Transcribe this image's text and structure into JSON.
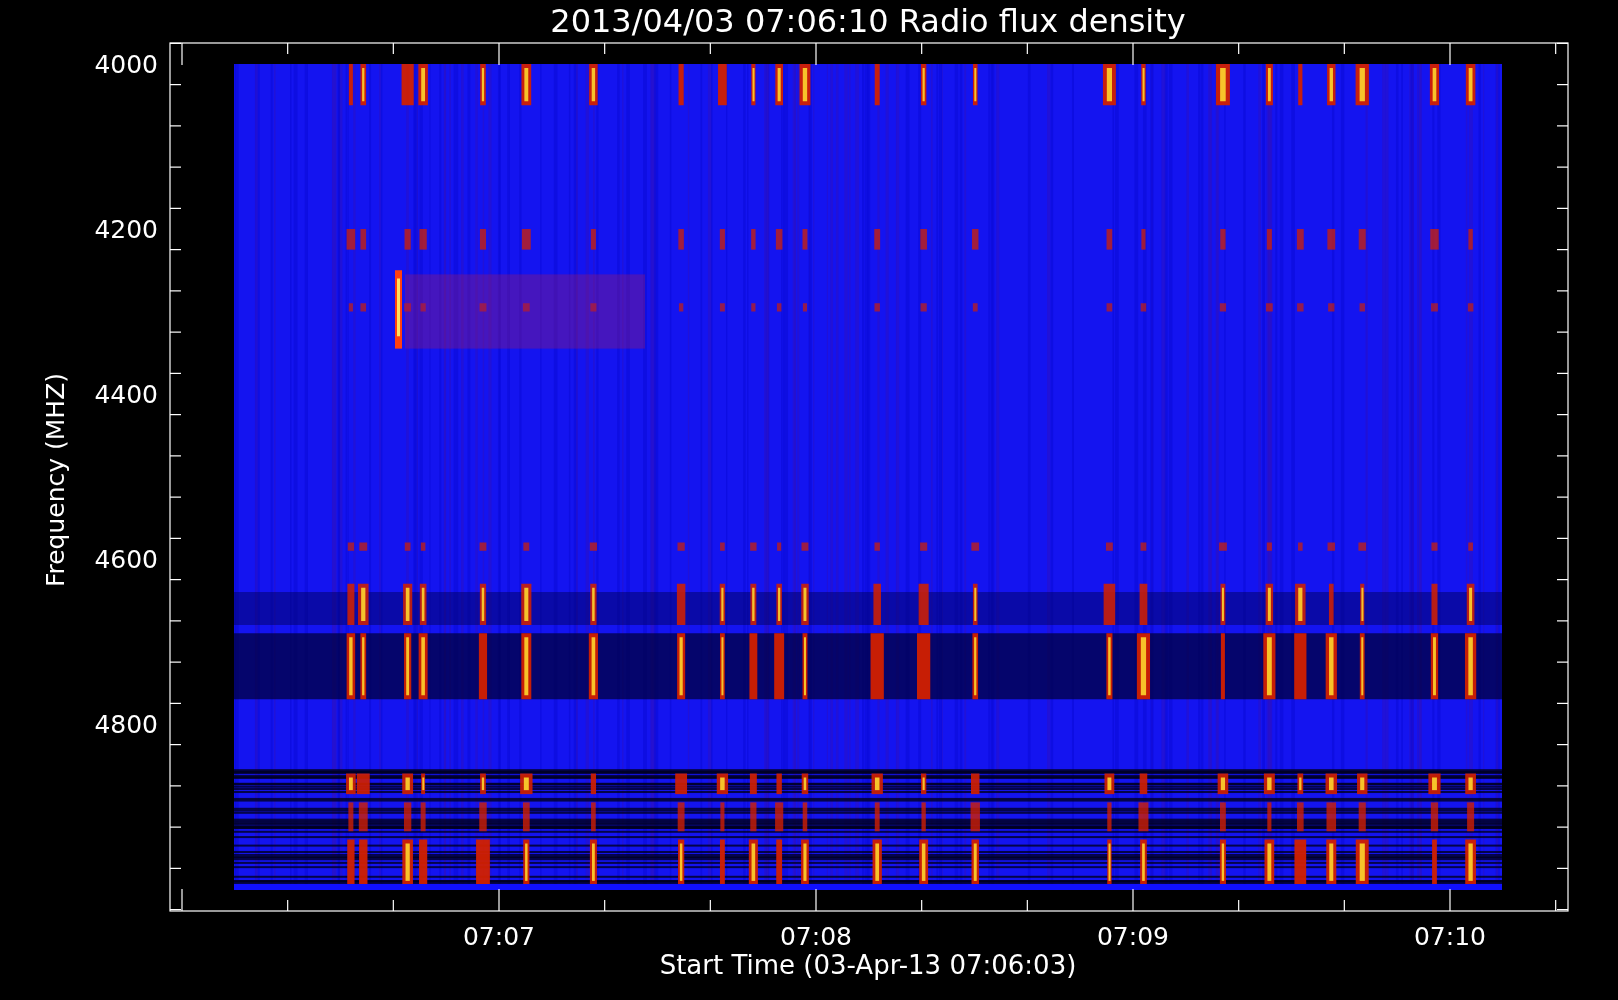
{
  "title": "2013/04/03 07:06:10 Radio flux density",
  "y_axis": {
    "label": "Frequency (MHZ)",
    "ticks": [
      "4000",
      "4200",
      "4400",
      "4600",
      "4800"
    ]
  },
  "x_axis": {
    "label": "Start Time (03-Apr-13 07:06:03)",
    "ticks": [
      "07:07",
      "07:08",
      "07:09",
      "07:10"
    ]
  }
}
